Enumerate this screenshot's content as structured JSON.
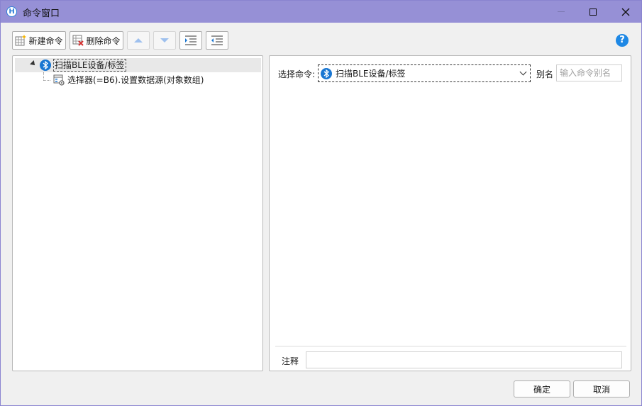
{
  "window": {
    "title": "命令窗口",
    "app_icon_letter": "H"
  },
  "toolbar": {
    "new_command": "新建命令",
    "delete_command": "删除命令",
    "help_glyph": "?"
  },
  "tree": {
    "items": [
      {
        "label": "扫描BLE设备/标签",
        "icon": "bluetooth-icon",
        "expanded": true
      },
      {
        "label": "选择器(=B6).设置数据源(对象数组)",
        "icon": "selector-settings-icon"
      }
    ]
  },
  "editor": {
    "select_label": "选择命令:",
    "selected_command": "扫描BLE设备/标签",
    "alias_label": "别名",
    "alias_placeholder": "输入命令别名",
    "alias_value": "",
    "note_label": "注释",
    "note_value": ""
  },
  "buttons": {
    "ok": "确定",
    "cancel": "取消"
  },
  "colors": {
    "titlebar": "#9690d6",
    "accent": "#1976d2",
    "selection": "#e8e8e8"
  }
}
